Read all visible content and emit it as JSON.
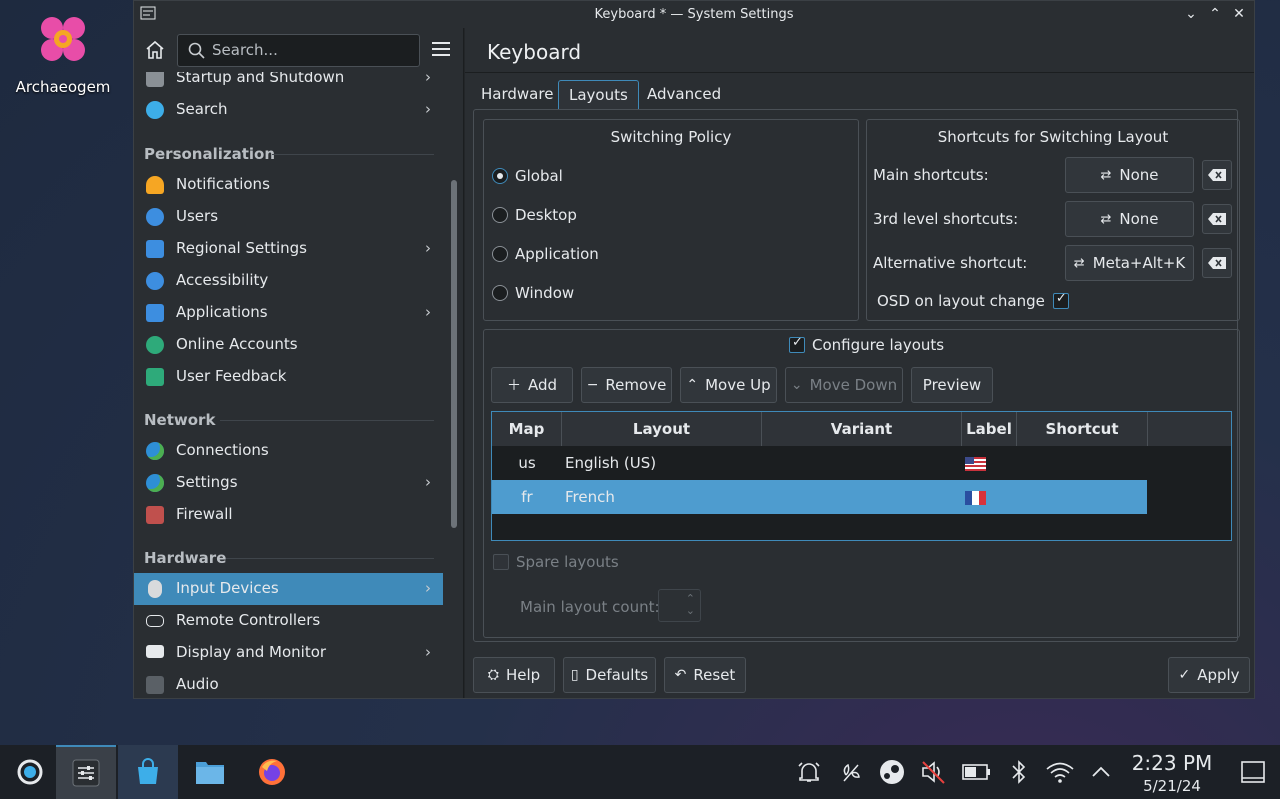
{
  "desktop": {
    "icon_label": "Archaeogem"
  },
  "window": {
    "title": "Keyboard * — System Settings"
  },
  "sidebar": {
    "search_placeholder": "Search...",
    "items": [
      {
        "label": "Startup and Shutdown",
        "icon": "startup-icon",
        "chevron": true
      },
      {
        "label": "Search",
        "icon": "search-icon",
        "chevron": true
      },
      {
        "label": "Notifications",
        "icon": "bell-icon",
        "chevron": false
      },
      {
        "label": "Users",
        "icon": "users-icon",
        "chevron": false
      },
      {
        "label": "Regional Settings",
        "icon": "regional-icon",
        "chevron": true
      },
      {
        "label": "Accessibility",
        "icon": "accessibility-icon",
        "chevron": false
      },
      {
        "label": "Applications",
        "icon": "applications-icon",
        "chevron": true
      },
      {
        "label": "Online Accounts",
        "icon": "online-accounts-icon",
        "chevron": false
      },
      {
        "label": "User Feedback",
        "icon": "feedback-icon",
        "chevron": false
      },
      {
        "label": "Connections",
        "icon": "globe-icon",
        "chevron": false
      },
      {
        "label": "Settings",
        "icon": "globe-icon",
        "chevron": true
      },
      {
        "label": "Firewall",
        "icon": "firewall-icon",
        "chevron": false
      },
      {
        "label": "Input Devices",
        "icon": "mouse-icon",
        "chevron": true
      },
      {
        "label": "Remote Controllers",
        "icon": "gamepad-icon",
        "chevron": false
      },
      {
        "label": "Display and Monitor",
        "icon": "monitor-icon",
        "chevron": true
      },
      {
        "label": "Audio",
        "icon": "speaker-icon",
        "chevron": false
      }
    ],
    "headings": {
      "personalization": "Personalization",
      "network": "Network",
      "hardware": "Hardware"
    }
  },
  "main": {
    "title": "Keyboard",
    "tabs": [
      "Hardware",
      "Layouts",
      "Advanced"
    ],
    "active_tab": "Layouts",
    "switching_policy": {
      "title": "Switching Policy",
      "options": [
        "Global",
        "Desktop",
        "Application",
        "Window"
      ],
      "selected": "Global"
    },
    "shortcuts": {
      "title": "Shortcuts for Switching Layout",
      "main_label": "Main shortcuts:",
      "main_value": "None",
      "third_label": "3rd level shortcuts:",
      "third_value": "None",
      "alt_label": "Alternative shortcut:",
      "alt_value": "Meta+Alt+K",
      "osd_label": "OSD on layout change"
    },
    "layouts": {
      "configure_label": "Configure layouts",
      "buttons": {
        "add": "Add",
        "remove": "Remove",
        "move_up": "Move Up",
        "move_down": "Move Down",
        "preview": "Preview"
      },
      "columns": [
        "Map",
        "Layout",
        "Variant",
        "Label",
        "Shortcut"
      ],
      "rows": [
        {
          "map": "us",
          "layout": "English (US)",
          "variant": "",
          "label_flag": "us-flag",
          "shortcut": ""
        },
        {
          "map": "fr",
          "layout": "French",
          "variant": "",
          "label_flag": "fr-flag",
          "shortcut": ""
        }
      ],
      "spare_label": "Spare layouts",
      "main_count_label": "Main layout count:"
    },
    "footer": {
      "help": "Help",
      "defaults": "Defaults",
      "reset": "Reset",
      "apply": "Apply"
    }
  },
  "taskbar": {
    "time": "2:23 PM",
    "date": "5/21/24"
  }
}
